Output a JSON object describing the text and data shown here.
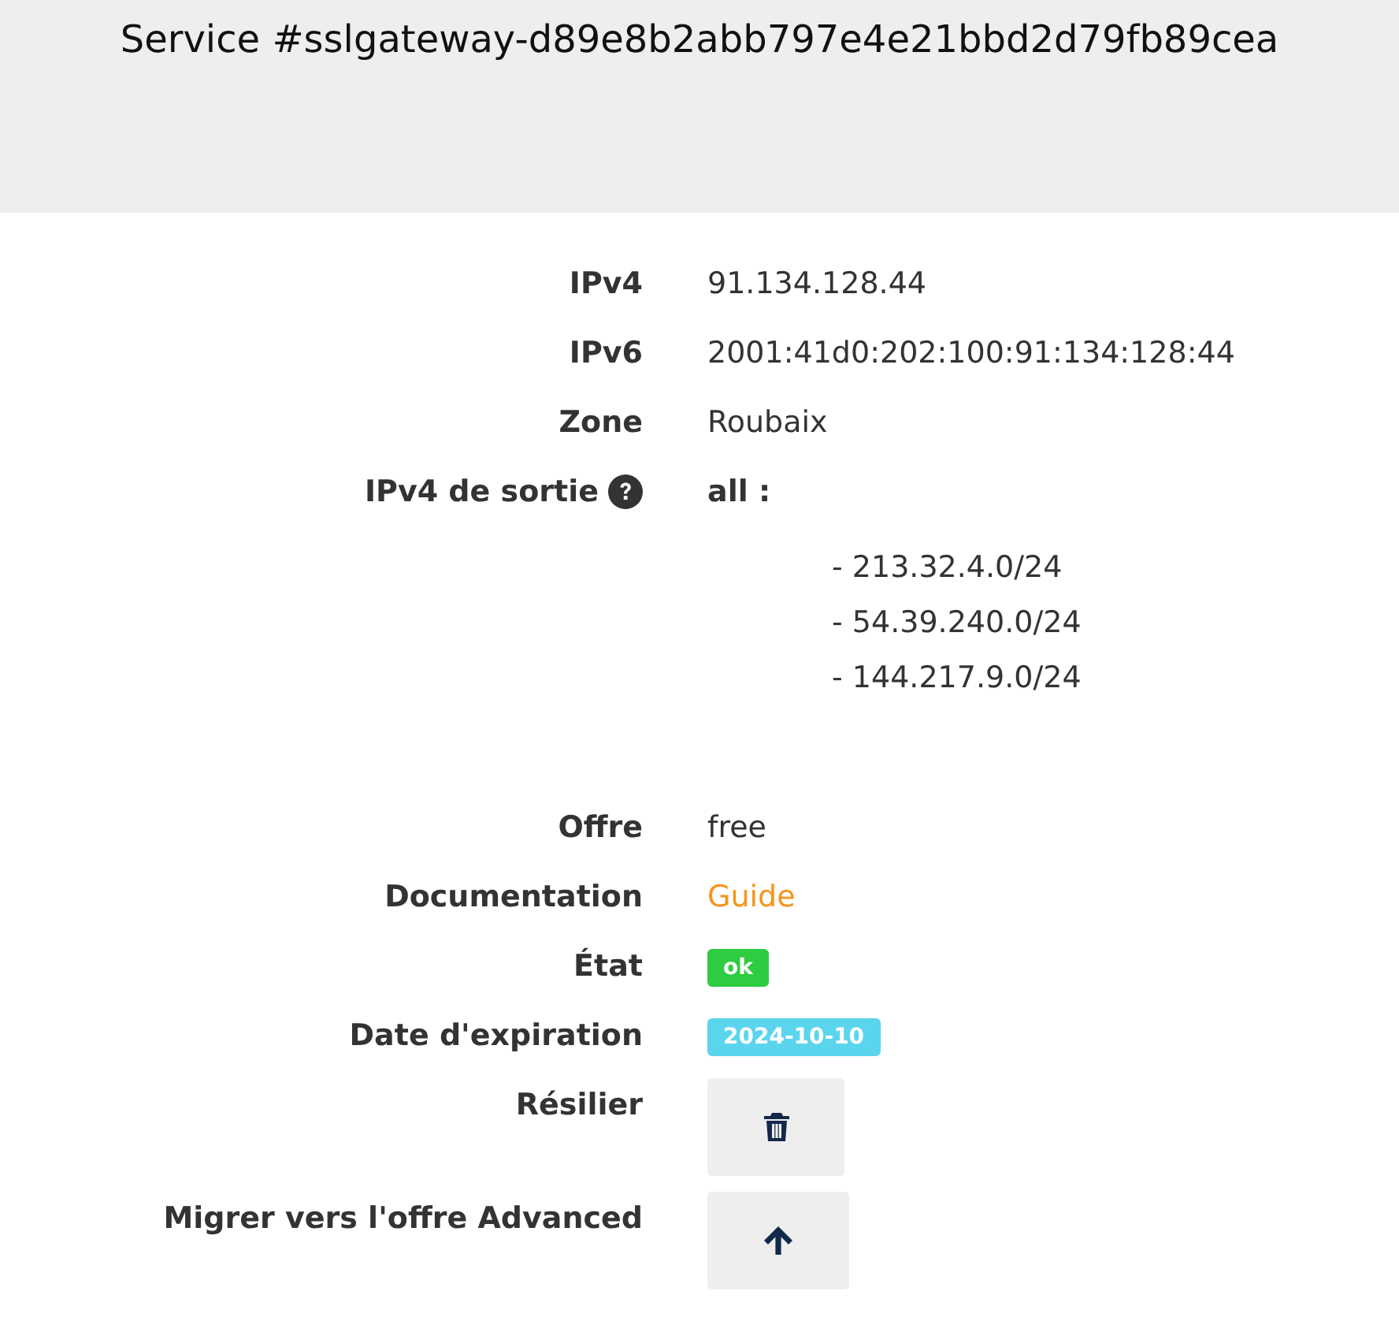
{
  "header": {
    "title": "Service #sslgateway-d89e8b2abb797e4e21bbd2d79fb89cea"
  },
  "fields": [
    {
      "label": "IPv4",
      "kind": "text",
      "value": "91.134.128.44"
    },
    {
      "label": "IPv6",
      "kind": "text",
      "value": "2001:41d0:202:100:91:134:128:44"
    },
    {
      "label": "Zone",
      "kind": "text",
      "value": "Roubaix"
    },
    {
      "label": "IPv4 de sortie",
      "help": true,
      "kind": "list",
      "value": "all :",
      "items": [
        "- 213.32.4.0/24",
        "- 54.39.240.0/24",
        "- 144.217.9.0/24"
      ]
    },
    {
      "label": "Offre",
      "kind": "text",
      "value": "free"
    },
    {
      "label": "Documentation",
      "kind": "link",
      "value": "Guide"
    },
    {
      "label": "État",
      "kind": "badge",
      "value": "ok",
      "color": "#2ecc40"
    },
    {
      "label": "Date d'expiration",
      "kind": "badge",
      "value": "2024-10-10",
      "color": "#5bd5ee"
    },
    {
      "label": "Résilier",
      "kind": "delete"
    },
    {
      "label": "Migrer vers l'offre Advanced",
      "kind": "upgrade"
    }
  ]
}
